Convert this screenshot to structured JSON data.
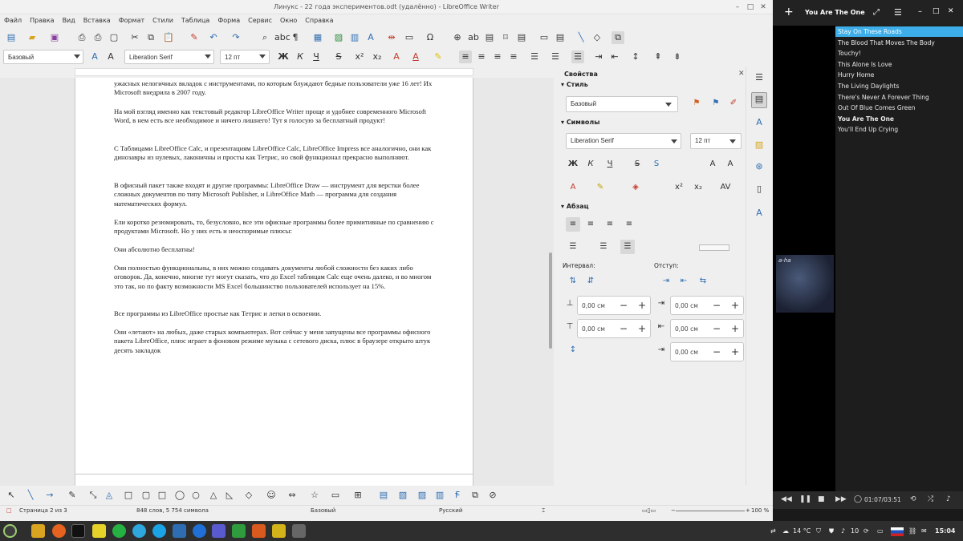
{
  "window": {
    "title": "Линукс - 22 года экспериментов.odt (удалённо) - LibreOffice Writer"
  },
  "menu": [
    "Файл",
    "Правка",
    "Вид",
    "Вставка",
    "Формат",
    "Стили",
    "Таблица",
    "Форма",
    "Сервис",
    "Окно",
    "Справка"
  ],
  "formatting": {
    "paragraph_style": "Базовый",
    "font_name": "Liberation Serif",
    "font_size": "12 пт"
  },
  "document": {
    "paragraphs": [
      "ужасных нелогичных вкладок с инструментами, по которым блуждают бедные пользователи уже 16 лет! Их Microsoft внедрила в 2007 году.",
      "На мой взгляд именно как текстовый редактор LibreOffice Writer проще и удобнее современного Microsoft Word, в нем есть все необходимое и ничего лишнего! Тут я голосую за бесплатный продукт!",
      "С Таблицами LibreOffice Calc, и презентациям LibreOffice Calc, LibreOffice Impress все аналогично, они как динозавры из нулевых, лаконичны и просты как Тетрис, но свой функционал прекрасно выполняют.",
      "В офисный пакет также входят и другие программы: LibreOffice Draw — инструмент для верстки более сложных документов по типу Microsoft Publisher, и LibreOffice Math — программа для создания математических формул.",
      "Ели коротко резюмировать, то, безусловно, все эти офисные программы более примитивные по сравнению с продуктами Microsoft. Но у них есть и неоспоримые плюсы:",
      "Они абсолютно бесплатны!",
      "Они полностью функциональны, в них можно создавать документы любой сложности без каких либо оговорок. Да, конечно, многие тут могут сказать, что до Excel таблицам Calc еще очень далеко, и во многом это так, но по факту возможности MS Excel большинство пользователей использует на 15%.",
      "Все программы из LibreOffice простые как Тетрис и легки в освоении.",
      "Они «летают» на любых, даже старых компьютерах. Вот сейчас у меня запущены все программы офисного пакета  LibreOffice, плюс играет в фоновом режиме музыка с сетевого диска, плюс в браузере открыто штук десять закладок"
    ]
  },
  "sidebar": {
    "title": "Свойства",
    "style_section": "Стиль",
    "style_value": "Базовый",
    "chars_section": "Символы",
    "font_value": "Liberation Serif",
    "size_value": "12 пт",
    "para_section": "Абзац",
    "interval_label": "Интервал:",
    "indent_label": "Отступ:",
    "spin_values": [
      "0,00 см",
      "0,00 см",
      "0,00 см",
      "0,00 см",
      "0,00 см"
    ]
  },
  "statusbar": {
    "page": "Страница 2 из 3",
    "words": "848 слов, 5 754 символа",
    "style": "Базовый",
    "language": "Русский",
    "zoom": "100 %"
  },
  "player": {
    "title": "You Are The One",
    "tracks": [
      "Stay On These Roads",
      "The Blood That Moves The Body",
      "Touchy!",
      "This Alone Is Love",
      "Hurry Home",
      "The Living Daylights",
      "There's Never A Forever Thing",
      "Out Of Blue Comes Green",
      "You Are The One",
      "You'll End Up Crying"
    ],
    "time": "01:07/03:51",
    "cover_text": "a-ha"
  },
  "taskbar": {
    "weather": "14 °C",
    "volume": "10",
    "clock": "15:04"
  },
  "colors": {
    "accent": "#3daee9",
    "player_bg": "#1d1d1d",
    "taskbar_bg": "#2e2e2e"
  }
}
